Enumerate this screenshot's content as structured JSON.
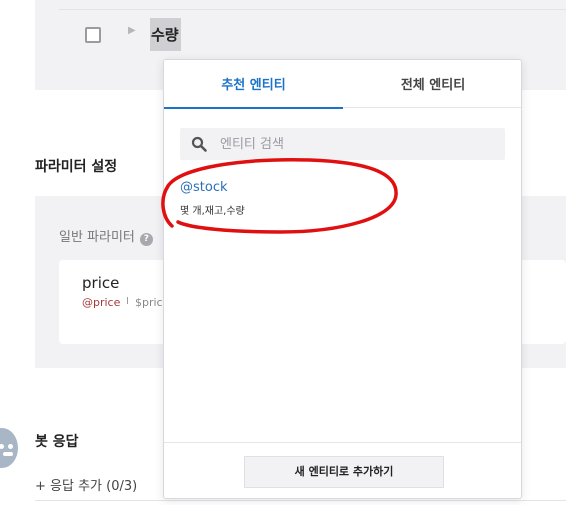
{
  "top_row": {
    "entity_chip": "수량"
  },
  "param_section": {
    "title": "파라미터 설정",
    "general_label": "일반 파라미터",
    "help_icon": "?",
    "param": {
      "name": "price",
      "entity": "@price",
      "separator": "I",
      "value": "$pric"
    }
  },
  "bot_section": {
    "title": "봇 응답",
    "add_response": "+ 응답 추가 (0/3)"
  },
  "popup": {
    "tabs": [
      {
        "label": "추천 엔티티"
      },
      {
        "label": "전체 엔티티"
      }
    ],
    "search": {
      "placeholder": "엔티티 검색",
      "value": ""
    },
    "entities": [
      {
        "name": "@stock",
        "synonyms": "몇 개,재고,수량"
      }
    ],
    "footer_button": "새 엔티티로 추가하기"
  },
  "colors": {
    "accent": "#1a73c8",
    "annotation": "#e01010",
    "entity_link": "#2a6ebb"
  },
  "icons": {
    "search": "search-icon",
    "help": "help-icon",
    "bot": "bot-avatar-icon",
    "caret": "caret-right-icon"
  }
}
